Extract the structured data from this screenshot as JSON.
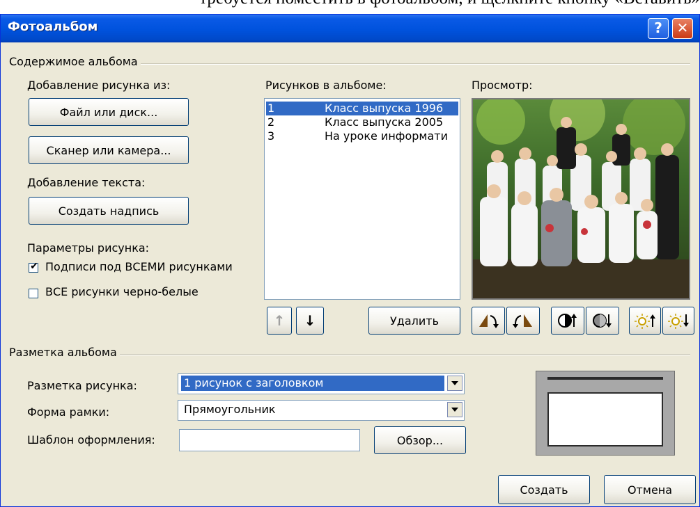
{
  "document_text": "требуется поместить в фотоальбом, и щелкните кнопку «Вставить»",
  "window": {
    "title": "Фотоальбом",
    "help_glyph": "?",
    "close_glyph": "✕"
  },
  "album_content": {
    "group_label": "Содержимое альбома",
    "add_picture_label": "Добавление рисунка из:",
    "file_button": "Файл или диск...",
    "scanner_button": "Сканер или камера...",
    "add_text_label": "Добавление текста:",
    "create_caption_button": "Создать надпись",
    "picture_options_label": "Параметры рисунка:",
    "captions_checkbox": {
      "label": "Подписи под ВСЕМИ рисунками",
      "checked": true
    },
    "bw_checkbox": {
      "label": "ВСЕ рисунки черно-белые",
      "checked": false
    },
    "pictures_label": "Рисунков в альбоме:",
    "pictures": [
      {
        "num": "1",
        "name": "Класс выпуска 1996",
        "selected": true
      },
      {
        "num": "2",
        "name": "Класс выпуска 2005",
        "selected": false
      },
      {
        "num": "3",
        "name": "На уроке информати",
        "selected": false
      }
    ],
    "move_up_glyph": "↑",
    "move_down_glyph": "↓",
    "delete_button": "Удалить",
    "preview_label": "Просмотр:",
    "preview_icons": [
      "rotate-left-icon",
      "rotate-right-icon",
      "contrast-up-icon",
      "contrast-down-icon",
      "brightness-up-icon",
      "brightness-down-icon"
    ]
  },
  "album_layout": {
    "group_label": "Разметка альбома",
    "picture_layout_label": "Разметка рисунка:",
    "picture_layout_value": "1 рисунок с заголовком",
    "frame_shape_label": "Форма рамки:",
    "frame_shape_value": "Прямоугольник",
    "design_template_label": "Шаблон оформления:",
    "design_template_value": "",
    "browse_button": "Обзор..."
  },
  "footer": {
    "create_button": "Создать",
    "cancel_button": "Отмена"
  }
}
